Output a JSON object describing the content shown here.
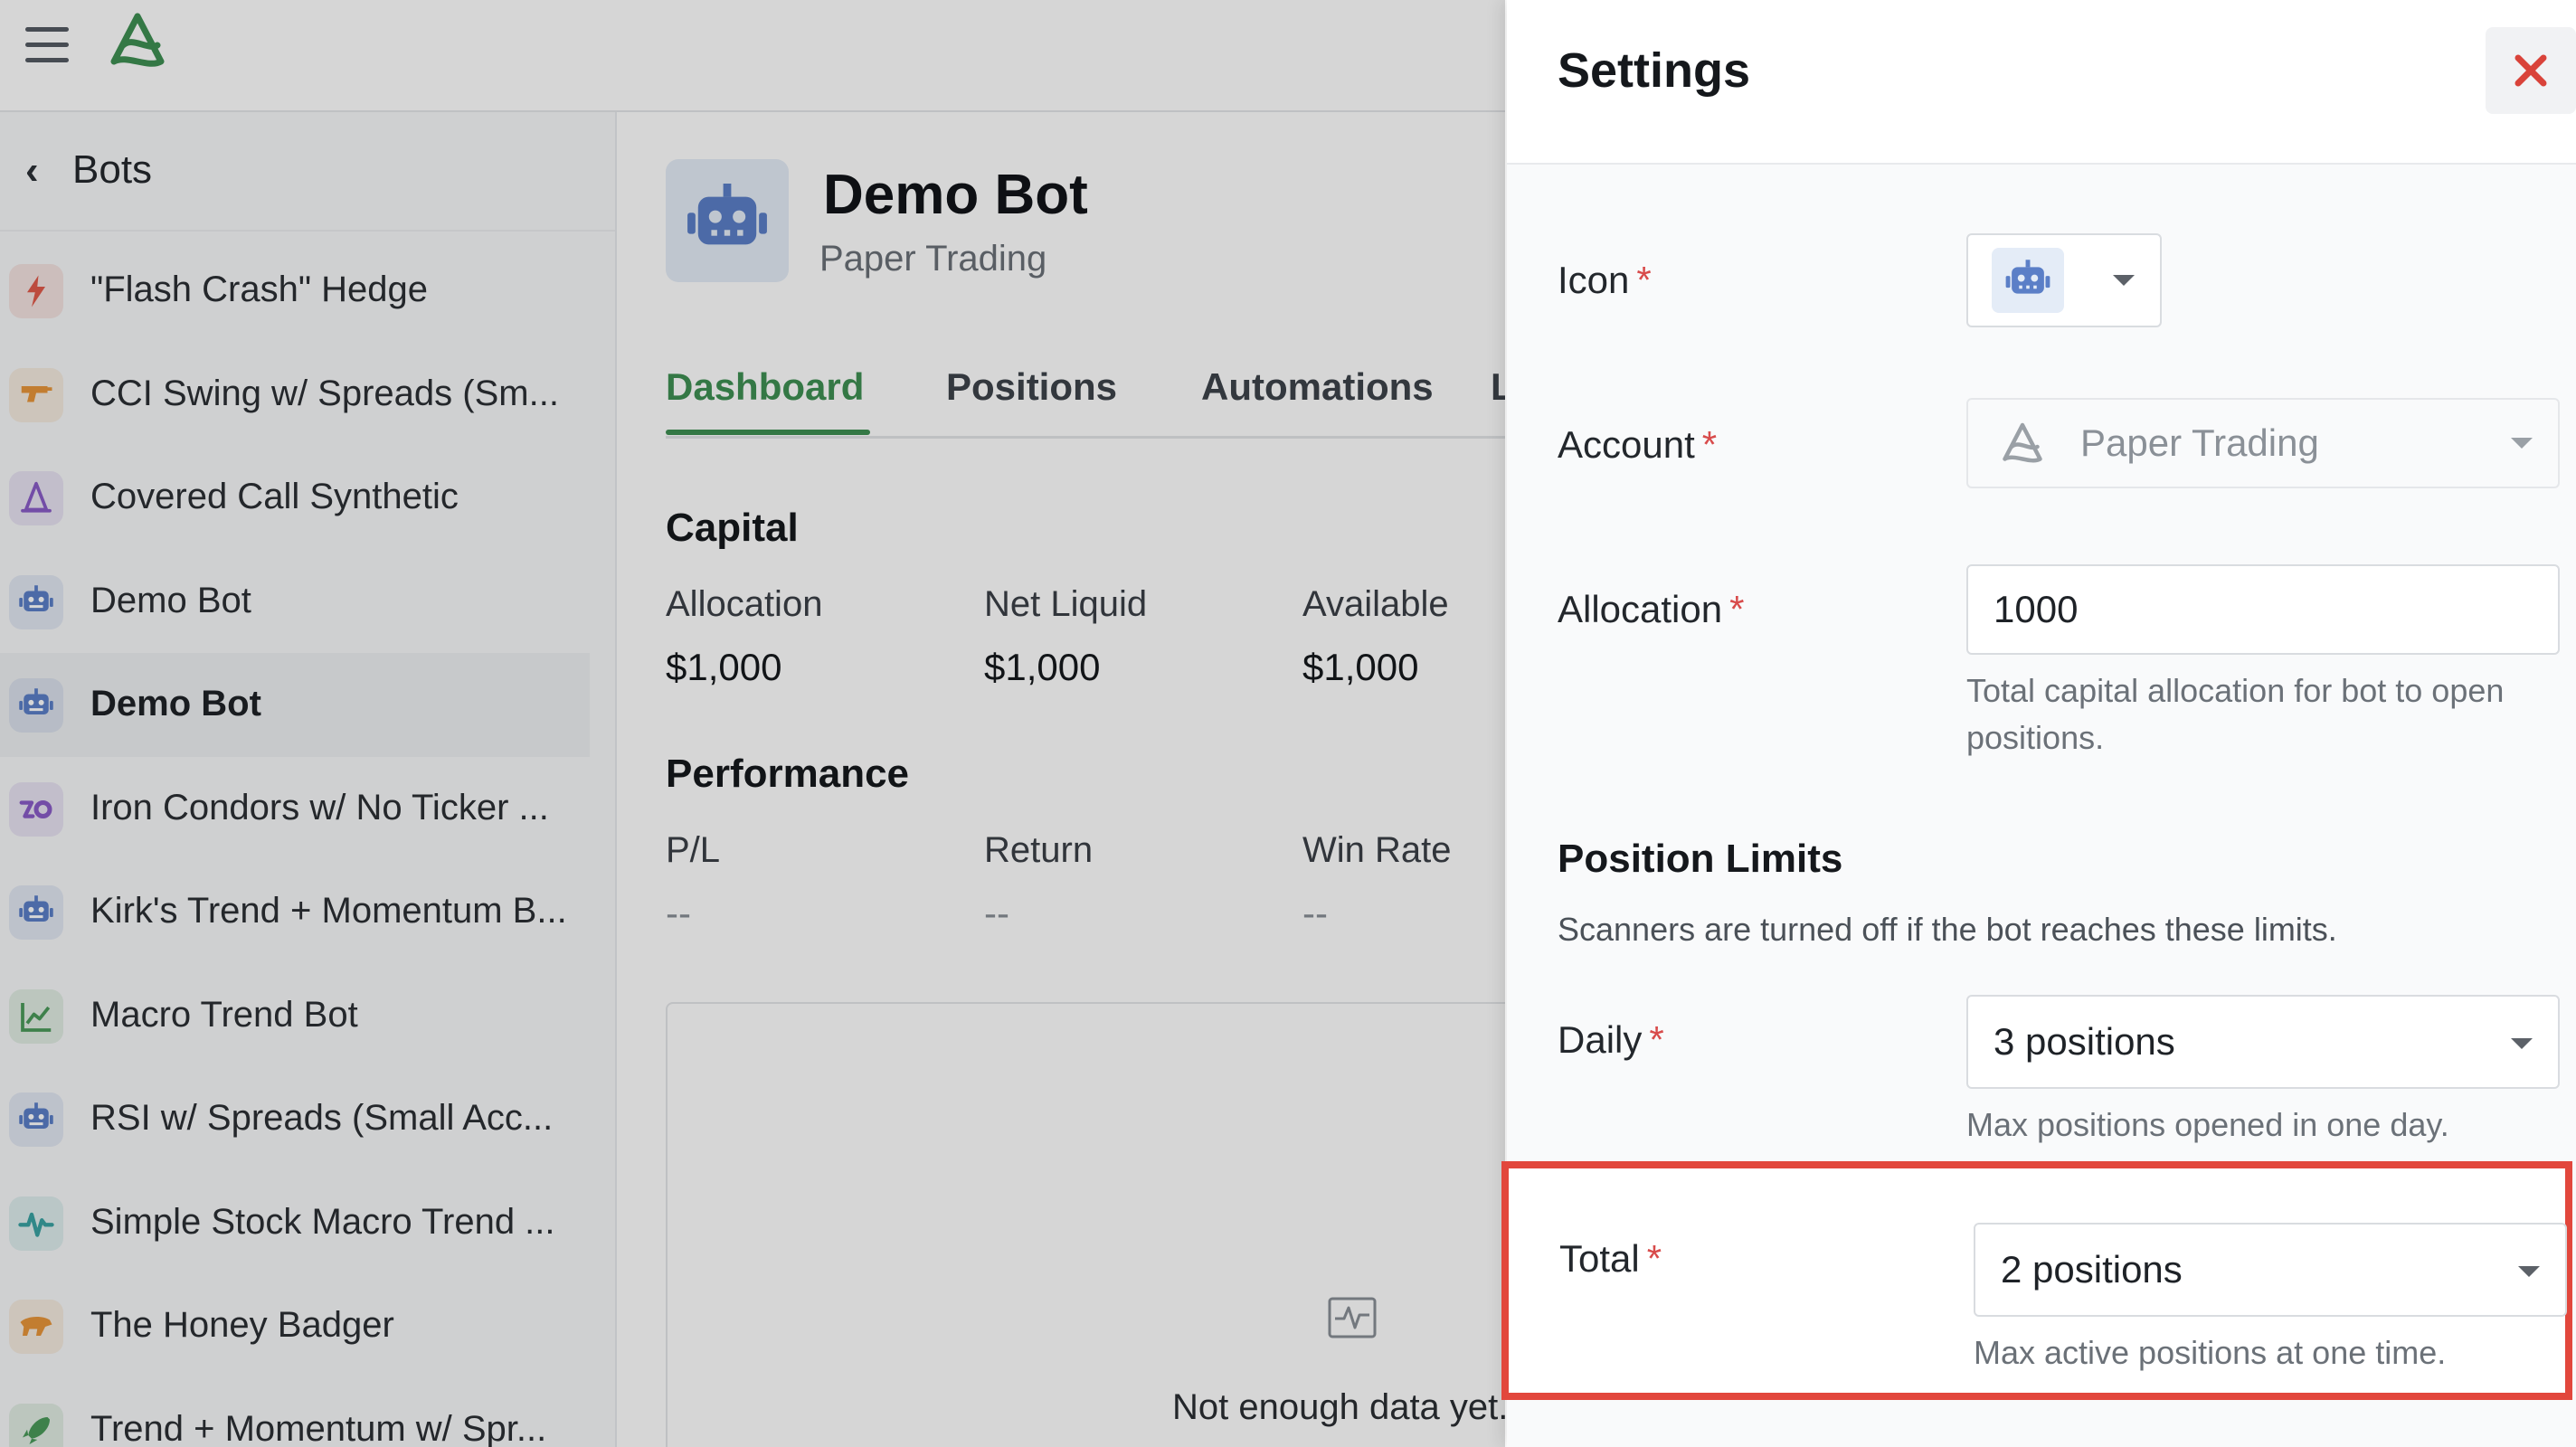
{
  "sidebar": {
    "back_label": "Bots",
    "items": [
      {
        "label": "\"Flash Crash\" Hedge",
        "icon": "lightning-icon",
        "color": "#e05a4a"
      },
      {
        "label": "CCI Swing w/ Spreads (Sm...",
        "icon": "gun-icon",
        "color": "#e8953a"
      },
      {
        "label": "Covered Call Synthetic",
        "icon": "wizard-hat-icon",
        "color": "#8a5cc7"
      },
      {
        "label": "Demo Bot",
        "icon": "robot-icon",
        "color": "#5b7fc7"
      },
      {
        "label": "Demo Bot",
        "icon": "robot-icon",
        "color": "#5b7fc7",
        "active": true
      },
      {
        "label": "Iron Condors w/ No Ticker ...",
        "icon": "infinity-icon",
        "color": "#8a5cc7"
      },
      {
        "label": "Kirk's Trend + Momentum B...",
        "icon": "robot-icon",
        "color": "#5b7fc7"
      },
      {
        "label": "Macro Trend Bot",
        "icon": "trend-chart-icon",
        "color": "#4a9a5a"
      },
      {
        "label": "RSI w/ Spreads (Small Acc...",
        "icon": "robot-icon",
        "color": "#5b7fc7"
      },
      {
        "label": "Simple Stock Macro Trend ...",
        "icon": "heartbeat-icon",
        "color": "#3aa3a3"
      },
      {
        "label": "The Honey Badger",
        "icon": "badger-icon",
        "color": "#e8953a"
      },
      {
        "label": "Trend + Momentum w/ Spr...",
        "icon": "rocket-icon",
        "color": "#4a9a5a"
      }
    ]
  },
  "main": {
    "title": "Demo Bot",
    "subtitle": "Paper Trading",
    "tabs": [
      {
        "label": "Dashboard",
        "active": true
      },
      {
        "label": "Positions"
      },
      {
        "label": "Automations"
      },
      {
        "label": "L"
      }
    ],
    "capital": {
      "title": "Capital",
      "stats": [
        {
          "label": "Allocation",
          "value": "$1,000"
        },
        {
          "label": "Net Liquid",
          "value": "$1,000"
        },
        {
          "label": "Available",
          "value": "$1,000"
        }
      ]
    },
    "performance": {
      "title": "Performance",
      "stats": [
        {
          "label": "P/L",
          "value": "--"
        },
        {
          "label": "Return",
          "value": "--"
        },
        {
          "label": "Win Rate",
          "value": "--"
        }
      ]
    },
    "chart_empty_text": "Not enough data yet."
  },
  "settings": {
    "title": "Settings",
    "icon": {
      "label": "Icon",
      "value": "robot-icon"
    },
    "account": {
      "label": "Account",
      "value": "Paper Trading"
    },
    "allocation": {
      "label": "Allocation",
      "value": "1000",
      "help": "Total capital allocation for bot to open positions."
    },
    "position_limits": {
      "title": "Position Limits",
      "description": "Scanners are turned off if the bot reaches these limits.",
      "daily": {
        "label": "Daily",
        "value": "3 positions",
        "help": "Max positions opened in one day."
      },
      "total": {
        "label": "Total",
        "value": "2 positions",
        "help": "Max active positions at one time."
      }
    }
  },
  "colors": {
    "brand_green": "#3f8f53",
    "required": "#d84b4b",
    "close": "#d9433a",
    "highlight": "#e2473c"
  }
}
